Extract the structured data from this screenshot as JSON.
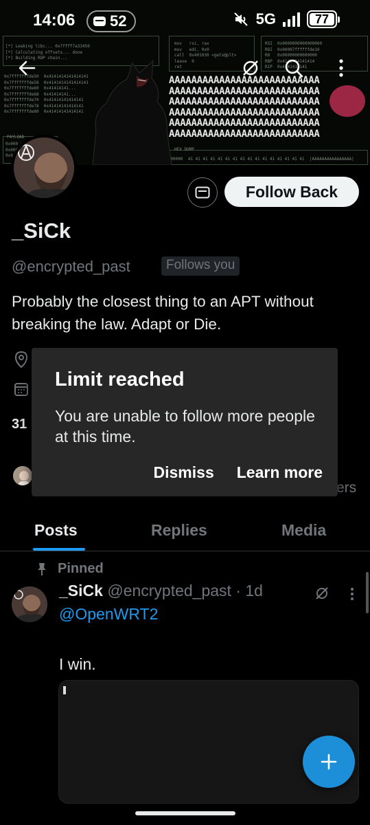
{
  "status_bar": {
    "time": "14:06",
    "notification_count": "52",
    "network": "5G",
    "battery": "77"
  },
  "banner": {
    "terminal_left": "[*] Leaking libc... 0x7ffff7a33450\n[*] Calculating offsets... done\n[*] Building ROP chain...",
    "terminal_asm": "mov   rsi, rax\nmov   edi, 0x0\ncall  0x401030 <gets@plt>\nleave  0\nret",
    "terminal_regs": "RSI  0x0000000000000000\nRDI  0x00007ffffffde10\nR8   0x00000000000000\nRBP  0x4141414141414\nRIP  0x4141414141",
    "stack_dump": "0x7fffffffde50  0x4141414141414141\n0x7fffffffde58  0x4141414141414141\n0x7fffffffde60  0x41414141...\n0x7fffffffde68  0x41414141...\n0x7fffffffde70  0x41414141414141\n0x7fffffffde78  0x41414141414141\n0x7fffffffde80  0x41414141414141",
    "payload_label": "PAYLOAD",
    "payload_lines": "0x000\n0x000\n0x0",
    "hexdump_label": "HEX DUMP",
    "hexdump_line": "0x0000000  41 41 41 41 41 41 41 41 41 41 41 41 41 41 41 41  |AAAAAAAAAAAAAAAA|",
    "aaa_lines": [
      "AAAAAAAAAAAAAAAAAAAAAAAAAAA",
      "AAAAAAAAAAAAAAAAAAAAAAAAAAA",
      "AAAAAAAAAAAAAAAAAAAAAAAAAAA",
      "AAAAAAAAAAAAAAAAAAAAAAAAAAA",
      "AAAAAAAAAAAAAAAAAAAAAAAAAAA",
      "AAAAAAAAAAAAAAAAAAAAAAAAAAA"
    ]
  },
  "profile": {
    "display_name": "_SiCk",
    "handle": "@encrypted_past",
    "follows_you": "Follows you",
    "bio": "Probably the closest thing to an APT without breaking the law. Adapt or Die.",
    "follow_button": "Follow Back",
    "count_partial": "31",
    "followers_partial": "ers"
  },
  "dialog": {
    "title": "Limit reached",
    "body": "You are unable to follow more people at this time.",
    "dismiss": "Dismiss",
    "learn_more": "Learn more"
  },
  "tabs": [
    {
      "label": "Posts",
      "active": true
    },
    {
      "label": "Replies",
      "active": false
    },
    {
      "label": "Media",
      "active": false
    }
  ],
  "post": {
    "pinned_label": "Pinned",
    "author_name": "_SiCk",
    "author_handle": "@encrypted_past · 1d",
    "mention": "@OpenWRT2",
    "text": "I win."
  },
  "colors": {
    "accent": "#1d9bf0",
    "background": "#000000",
    "dialog_bg": "#272727",
    "muted_text": "#71767b"
  }
}
